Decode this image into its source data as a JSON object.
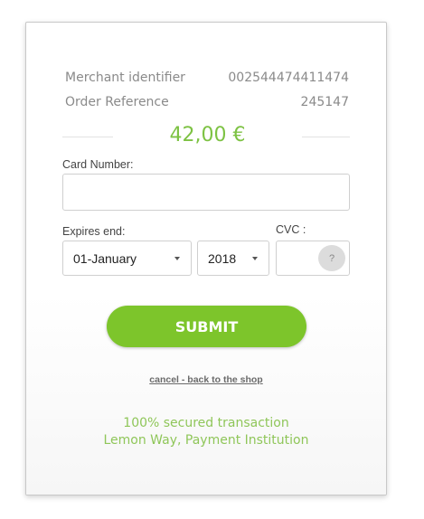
{
  "merchant": {
    "identifier_label": "Merchant identifier",
    "identifier_value": "002544474411474",
    "order_label": "Order Reference",
    "order_value": "245147"
  },
  "amount": "42,00 €",
  "card": {
    "number_label": "Card Number:",
    "number_value": ""
  },
  "expiry": {
    "label": "Expires end:",
    "month": "01-January",
    "year": "2018"
  },
  "cvc": {
    "label": "CVC :",
    "value": "",
    "help": "?"
  },
  "actions": {
    "submit": "SUBMIT",
    "cancel": "cancel - back to the shop"
  },
  "footer": {
    "line1": "100% secured transaction",
    "line2": "Lemon Way, Payment Institution"
  },
  "colors": {
    "accent": "#7dc52b",
    "amount": "#7dc243",
    "footer_text": "#8fc659"
  }
}
